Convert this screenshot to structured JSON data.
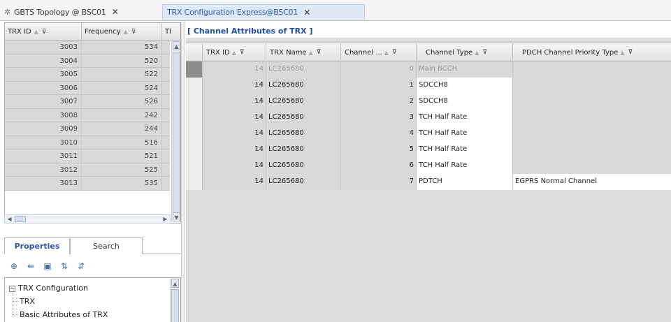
{
  "tabs": [
    {
      "label": "GBTS Topology @ BSC01",
      "active": false
    },
    {
      "label": "TRX Configuration Express@BSC01",
      "active": true
    }
  ],
  "left_grid": {
    "columns": [
      "TRX ID",
      "Frequency",
      "TI"
    ],
    "rows": [
      {
        "trx_id": "3003",
        "frequency": "534"
      },
      {
        "trx_id": "3004",
        "frequency": "520"
      },
      {
        "trx_id": "3005",
        "frequency": "522"
      },
      {
        "trx_id": "3006",
        "frequency": "524"
      },
      {
        "trx_id": "3007",
        "frequency": "526"
      },
      {
        "trx_id": "3008",
        "frequency": "242"
      },
      {
        "trx_id": "3009",
        "frequency": "244"
      },
      {
        "trx_id": "3010",
        "frequency": "516"
      },
      {
        "trx_id": "3011",
        "frequency": "521"
      },
      {
        "trx_id": "3012",
        "frequency": "525"
      },
      {
        "trx_id": "3013",
        "frequency": "535"
      }
    ]
  },
  "properties_tabs": [
    "Properties",
    "Search"
  ],
  "toolbar_icons": [
    "locate-icon",
    "back-icon",
    "save-icon",
    "sort-ascending-icon",
    "sort-descending-icon"
  ],
  "tree": {
    "root": "TRX Configuration",
    "children": [
      "TRX",
      "Basic Attributes of TRX"
    ]
  },
  "right_title": "[ Channel Attributes of TRX ]",
  "right_grid": {
    "columns": [
      "TRX ID",
      "TRX Name",
      "Channel ...",
      "Channel Type",
      "PDCH Channel Priority Type"
    ],
    "rows": [
      {
        "trx_id": "14",
        "trx_name": "LC265680",
        "channel": "0",
        "channel_type": "Main BCCH",
        "pdch": ""
      },
      {
        "trx_id": "14",
        "trx_name": "LC265680",
        "channel": "1",
        "channel_type": "SDCCH8",
        "pdch": ""
      },
      {
        "trx_id": "14",
        "trx_name": "LC265680",
        "channel": "2",
        "channel_type": "SDCCH8",
        "pdch": ""
      },
      {
        "trx_id": "14",
        "trx_name": "LC265680",
        "channel": "3",
        "channel_type": "TCH Half Rate",
        "pdch": ""
      },
      {
        "trx_id": "14",
        "trx_name": "LC265680",
        "channel": "4",
        "channel_type": "TCH Half Rate",
        "pdch": ""
      },
      {
        "trx_id": "14",
        "trx_name": "LC265680",
        "channel": "5",
        "channel_type": "TCH Half Rate",
        "pdch": ""
      },
      {
        "trx_id": "14",
        "trx_name": "LC265680",
        "channel": "6",
        "channel_type": "TCH Half Rate",
        "pdch": ""
      },
      {
        "trx_id": "14",
        "trx_name": "LC265680",
        "channel": "7",
        "channel_type": "PDTCH",
        "pdch": "EGPRS Normal Channel"
      }
    ]
  },
  "colors": {
    "accent": "#2b57a6",
    "title": "#1f4fa3",
    "cell_gray": "#d9d9d9"
  }
}
